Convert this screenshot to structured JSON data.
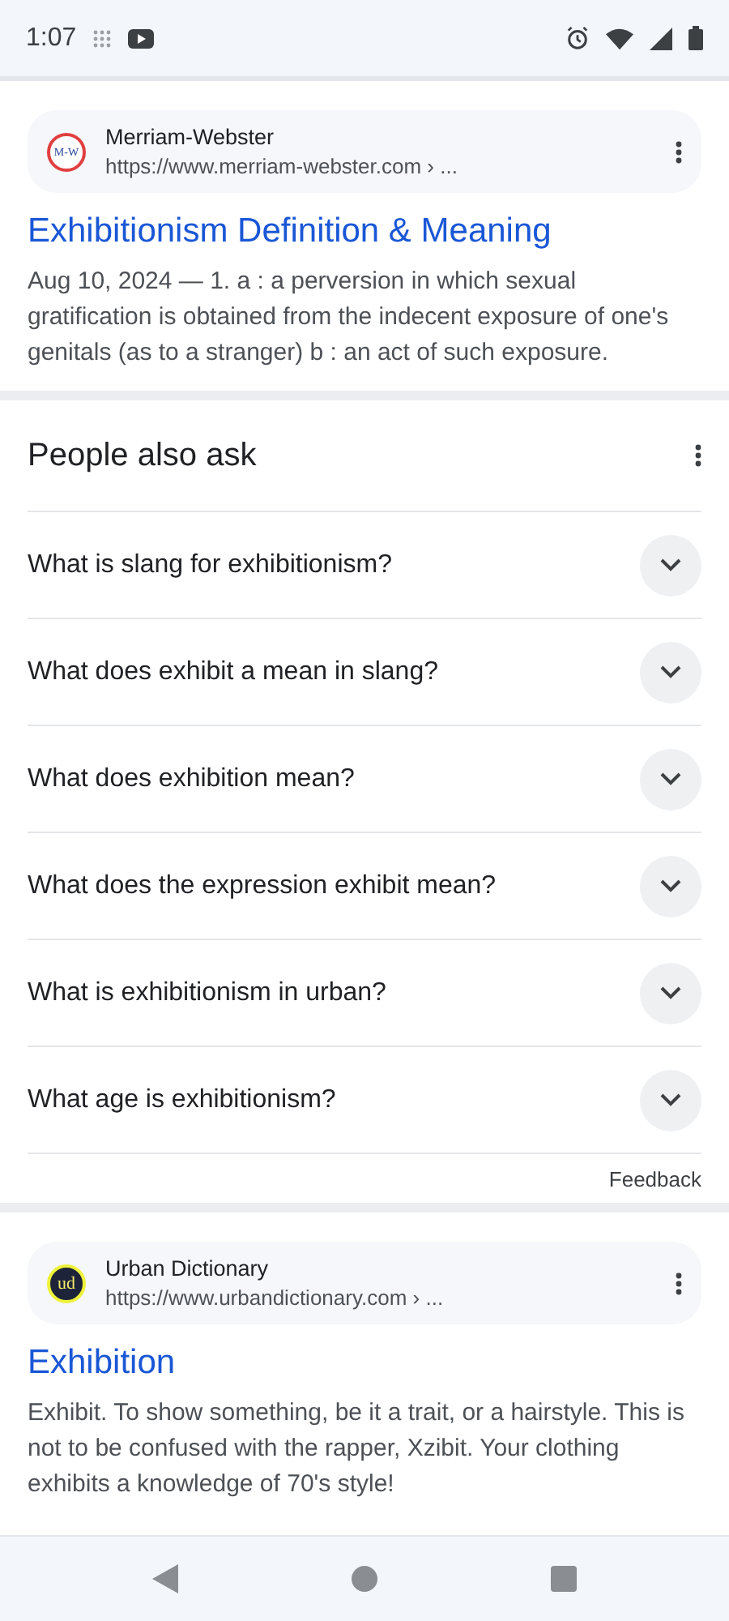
{
  "status_bar": {
    "time": "1:07"
  },
  "results": [
    {
      "site": "Merriam-Webster",
      "logo_text": "M-W",
      "kind": "mw",
      "url": "https://www.merriam-webster.com › ...",
      "title": "Exhibitionism Definition & Meaning",
      "snippet": "Aug 10, 2024 — 1. a : a perversion in which sexual gratification is obtained from the indecent exposure of one's genitals (as to a stranger) b : an act of such exposure."
    },
    {
      "site": "Urban Dictionary",
      "logo_text": "ud",
      "kind": "ud",
      "url": "https://www.urbandictionary.com › ...",
      "title": "Exhibition",
      "snippet": "Exhibit. To show something, be it a trait, or a hairstyle. This is not to be confused with the rapper, Xzibit. Your clothing exhibits a knowledge of 70's style!"
    }
  ],
  "people_also_ask": {
    "title": "People also ask",
    "questions": [
      {
        "text": "What is slang for exhibitionism?",
        "expanded": false
      },
      {
        "text": "What does exhibit a mean in slang?",
        "expanded": false
      },
      {
        "text": "What does exhibition mean?",
        "expanded": false
      },
      {
        "text": "What does the expression exhibit mean?",
        "expanded": false
      },
      {
        "text": "What is exhibitionism in urban?",
        "expanded": false
      },
      {
        "text": "What age is exhibitionism?",
        "expanded": false
      }
    ],
    "feedback": "Feedback"
  }
}
